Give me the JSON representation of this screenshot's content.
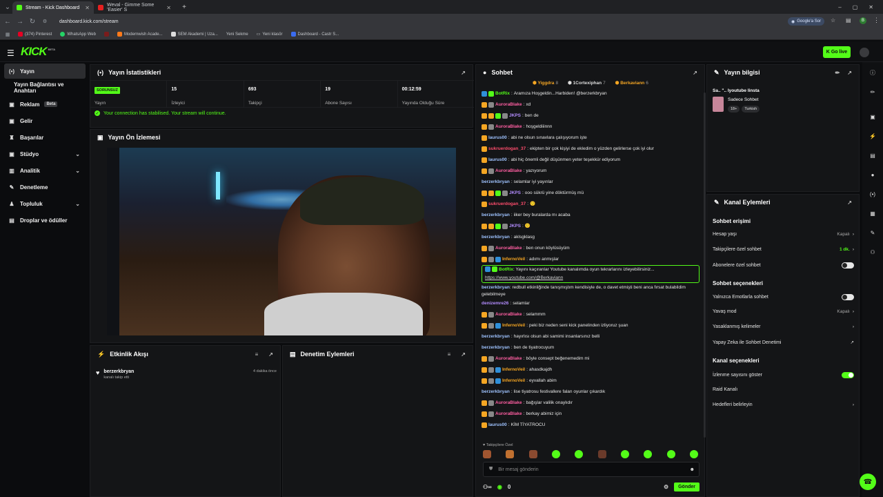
{
  "browser": {
    "tabs": [
      {
        "title": "Stream - Kick Dashboard",
        "color": "#53fc18"
      },
      {
        "title": "Weval - Gimme Some 'Easier' S",
        "color": "#e52020"
      }
    ],
    "url": "dashboard.kick.com/stream",
    "gemini": "Google'a Sor",
    "bookmarks": [
      "(374) Pinterest",
      "WhatsApp Web",
      "Modernwish Acade...",
      "SEM Akademi | Uza...",
      "Yeni Sekme",
      "Yeni klasör",
      "Dashboard - Castr S..."
    ]
  },
  "app": {
    "logo": "KICK",
    "logo_badge": "BETA",
    "go_live": "Go live"
  },
  "sidebar": {
    "items": [
      {
        "label": "Yayın",
        "icon": "(•)",
        "active": true
      },
      {
        "label": "Yayın Bağlantısı ve Anahtarı",
        "icon": "",
        "active": false
      },
      {
        "label": "Reklam",
        "icon": "▣",
        "badge": "Beta"
      },
      {
        "label": "Gelir",
        "icon": "▣"
      },
      {
        "label": "Başarılar",
        "icon": "♜"
      },
      {
        "label": "Stüdyo",
        "icon": "▣",
        "chevron": true
      },
      {
        "label": "Analitik",
        "icon": "▥",
        "chevron": true
      },
      {
        "label": "Denetleme",
        "icon": "✎"
      },
      {
        "label": "Topluluk",
        "icon": "♟",
        "chevron": true
      },
      {
        "label": "Droplar ve ödüller",
        "icon": "▤"
      }
    ]
  },
  "stats": {
    "title": "Yayın İstatistikleri",
    "items": [
      {
        "value": "SORUNSUZ",
        "label": "Yayın"
      },
      {
        "value": "15",
        "label": "İzleyici"
      },
      {
        "value": "693",
        "label": "Takipçi"
      },
      {
        "value": "19",
        "label": "Abone Sayısı"
      },
      {
        "value": "00:12:59",
        "label": "Yayında Olduğu Süre"
      }
    ],
    "status": "Your connection has stabilised. Your stream will continue."
  },
  "preview": {
    "title": "Yayın Ön İzlemesi"
  },
  "activity": {
    "title": "Etkinlik Akışı",
    "user": "berzerkbryan",
    "action": "kanalı takip etti",
    "time": "4 dakika önce"
  },
  "moderation": {
    "title": "Denetim Eylemleri"
  },
  "chat": {
    "title": "Sohbet",
    "top": [
      {
        "name": "Yiggdra",
        "n": "8",
        "color": "#f5a623"
      },
      {
        "name": "1Cortexiphan",
        "n": "7",
        "color": "#dddddd"
      },
      {
        "name": "Berkaviann",
        "n": "6",
        "color": "#f5a623"
      }
    ],
    "messages": [
      {
        "user": "BotRix",
        "color": "#53fc18",
        "text": "Aramıza Hoşgeldin...Harbiden! @berzerkbryan",
        "badges": [
          "#2f8fd8",
          "#53fc18"
        ]
      },
      {
        "user": "AuroraBlake",
        "color": "#ff5fa2",
        "text": "xd",
        "badges": [
          "#f5a623",
          "#888"
        ]
      },
      {
        "user": "JKPS",
        "color": "#b38cff",
        "text": "ben de",
        "badges": [
          "#f5a623",
          "#f5a623",
          "#53fc18",
          "#888"
        ]
      },
      {
        "user": "AuroraBlake",
        "color": "#ff5fa2",
        "text": "hoşgeldiiinnn",
        "badges": [
          "#f5a623",
          "#888"
        ]
      },
      {
        "user": "laurus00",
        "color": "#9fc3ff",
        "text": "abi ne olsun sınavlara çalışıyorum işte",
        "badges": [
          "#f5a623"
        ]
      },
      {
        "user": "sukruerdogan_37",
        "color": "#ff4d6d",
        "text": "ekipten bir çok kişiyi de ekledim o yüzden gelirlerse çok iyi olur",
        "badges": [
          "#f5a623"
        ]
      },
      {
        "user": "laurus00",
        "color": "#9fc3ff",
        "text": "abi hiç önemli değil düşünmen yeter teşekkür ediyorum",
        "badges": [
          "#f5a623"
        ]
      },
      {
        "user": "AuroraBlake",
        "color": "#ff5fa2",
        "text": "yazıyorum",
        "badges": [
          "#f5a623",
          "#888"
        ]
      },
      {
        "user": "berzerkbryan",
        "color": "#9fc3ff",
        "text": "selamlar iyi yayınlar",
        "badges": []
      },
      {
        "user": "JKPS",
        "color": "#b38cff",
        "text": "ooo sükrü yine döktürmüş mü",
        "badges": [
          "#f5a623",
          "#f5a623",
          "#53fc18",
          "#888"
        ]
      },
      {
        "user": "sukruerdogan_37",
        "color": "#ff4d6d",
        "text": "🙂",
        "badges": [
          "#f5a623"
        ]
      },
      {
        "user": "berzerkbryan",
        "color": "#9fc3ff",
        "text": "iiker bey buralarda mı acaba",
        "badges": []
      },
      {
        "user": "JKPS",
        "color": "#b38cff",
        "text": "🙂",
        "badges": [
          "#f5a623",
          "#f5a623",
          "#53fc18",
          "#888"
        ]
      },
      {
        "user": "berzerkbryan",
        "color": "#9fc3ff",
        "text": "aklsgklasg",
        "badges": []
      },
      {
        "user": "AuroraBlake",
        "color": "#ff5fa2",
        "text": "ben onun köylüsüyüm",
        "badges": [
          "#f5a623",
          "#888"
        ]
      },
      {
        "user": "InfernoVeil",
        "color": "#f5a623",
        "text": "adımı anmışlar",
        "badges": [
          "#f5a623",
          "#888",
          "#2f8fd8"
        ]
      },
      {
        "user": "BotRix",
        "color": "#53fc18",
        "text": "Yayını kaçıranlar Youtube kanalımda oyun tekrarlarını izleyebilirsiniz...",
        "link": "https://www.youtube.com/@Berkaviann",
        "highlight": true,
        "badges": [
          "#2f8fd8",
          "#53fc18"
        ]
      },
      {
        "user": "berzerkbryan",
        "color": "#9fc3ff",
        "text": "redbull etkinliğinde tanışmıştım kendisiyle de, o davet etmişti beni anca fırsat bulabildim gelebilmeye",
        "two": true,
        "badges": []
      },
      {
        "user": "denizemre26",
        "color": "#b38cff",
        "text": "selamlar",
        "badges": []
      },
      {
        "user": "AuroraBlake",
        "color": "#ff5fa2",
        "text": "selammm",
        "badges": [
          "#f5a623",
          "#888"
        ]
      },
      {
        "user": "InfernoVeil",
        "color": "#f5a623",
        "text": "peki biz neden seni kick panelinden izliyoruz şuan",
        "badges": [
          "#f5a623",
          "#888",
          "#2f8fd8"
        ]
      },
      {
        "user": "berzerkbryan",
        "color": "#9fc3ff",
        "text": "hayırlısı olsun abi samimi insanlarsınız belli",
        "badges": []
      },
      {
        "user": "berzerkbryan",
        "color": "#9fc3ff",
        "text": "ben de tiyatrocuyum",
        "badges": []
      },
      {
        "user": "AuroraBlake",
        "color": "#ff5fa2",
        "text": "böyle consept beğenemedim mi",
        "badges": [
          "#f5a623",
          "#888"
        ]
      },
      {
        "user": "InfernoVeil",
        "color": "#f5a623",
        "text": "ahasdkajdh",
        "badges": [
          "#f5a623",
          "#888",
          "#2f8fd8"
        ]
      },
      {
        "user": "InfernoVeil",
        "color": "#f5a623",
        "text": "eyvallah abim",
        "badges": [
          "#f5a623",
          "#888",
          "#2f8fd8"
        ]
      },
      {
        "user": "berzerkbryan",
        "color": "#9fc3ff",
        "text": "lise tiyatrosu festivallere falan oyunlar çıkardık",
        "badges": []
      },
      {
        "user": "AuroraBlake",
        "color": "#ff5fa2",
        "text": "bağışlar valilik onaylıdır",
        "badges": [
          "#f5a623",
          "#888"
        ]
      },
      {
        "user": "AuroraBlake",
        "color": "#ff5fa2",
        "text": "berkay abimiz için",
        "badges": [
          "#f5a623",
          "#888"
        ]
      },
      {
        "user": "laurus00",
        "color": "#9fc3ff",
        "text": "KİM TİYATROCU",
        "badges": [
          "#f5a623"
        ]
      }
    ],
    "emote_label": "♥ Takipçilere Özel",
    "input_placeholder": "Bir mesaj gönderin",
    "points": "0",
    "send": "Gönder"
  },
  "stream_info": {
    "title": "Yayın bilgisi",
    "stream_title": "Sa.. \"..  lyoutube linsta",
    "category": "Sadece Sohbet",
    "tags": [
      "18+",
      "Turkish"
    ]
  },
  "channel_actions": {
    "title": "Kanal Eylemleri",
    "sec1": "Sohbet erişimi",
    "account_age": {
      "label": "Hesap yaşı",
      "value": "Kapalı"
    },
    "followers_only": {
      "label": "Takipçilere özel sohbet",
      "value": "1 dk."
    },
    "subs_only": {
      "label": "Abonelere özel sohbet"
    },
    "sec2": "Sohbet seçenekleri",
    "emote_only": {
      "label": "Yalnızca Emotlarla sohbet"
    },
    "slow_mode": {
      "label": "Yavaş mod",
      "value": "Kapalı"
    },
    "banned_words": {
      "label": "Yasaklanmış kelimeler"
    },
    "ai_mod": {
      "label": "Yapay Zeka ile Sohbet Denetimi"
    },
    "sec3": "Kanal seçenekleri",
    "show_viewers": {
      "label": "İzlenme sayısını göster"
    },
    "raid": {
      "label": "Raid Kanalı"
    },
    "targets": {
      "label": "Hedefleri belirleyin"
    }
  }
}
